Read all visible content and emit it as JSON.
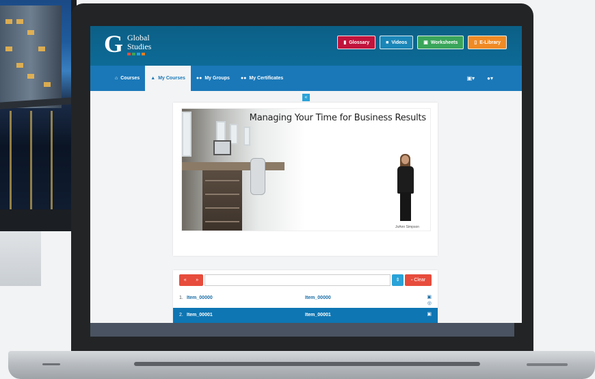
{
  "app": {
    "logo_mark": "G",
    "logo_line1": "Global",
    "logo_line2": "Studies"
  },
  "header_buttons": [
    {
      "label": "Glossary",
      "icon": "bookmark-icon",
      "color": "#c0143c"
    },
    {
      "label": "Videos",
      "icon": "video-icon",
      "color": "#1a86b8"
    },
    {
      "label": "Worksheets",
      "icon": "document-icon",
      "color": "#3aa55a"
    },
    {
      "label": "E-Library",
      "icon": "book-icon",
      "color": "#f08a24"
    }
  ],
  "nav": {
    "items": [
      {
        "label": "Courses",
        "icon": "home-icon",
        "active": false
      },
      {
        "label": "My Courses",
        "icon": "graduation-cap-icon",
        "active": true
      },
      {
        "label": "My Groups",
        "icon": "users-icon",
        "active": false
      },
      {
        "label": "My Certificates",
        "icon": "users-icon",
        "active": false
      }
    ],
    "right_icons": [
      "language-icon",
      "user-icon"
    ]
  },
  "slide": {
    "title": "Managing Your Time for Business Results",
    "presenter": "JoAnn Simpson"
  },
  "playlist": {
    "search_value": "",
    "clear_label": "Clear",
    "rows": [
      {
        "num": "1.",
        "title": "Item_00000",
        "title2": "Item_00000",
        "selected": false
      },
      {
        "num": "2.",
        "title": "Item_00001",
        "title2": "Item_00001",
        "selected": true
      }
    ]
  },
  "colors": {
    "header_bg": "#0b5f86",
    "nav_bg": "#1a78b8",
    "accent_red": "#e74c3c",
    "accent_blue": "#2aa3d8",
    "selected_row": "#0e76b3"
  }
}
